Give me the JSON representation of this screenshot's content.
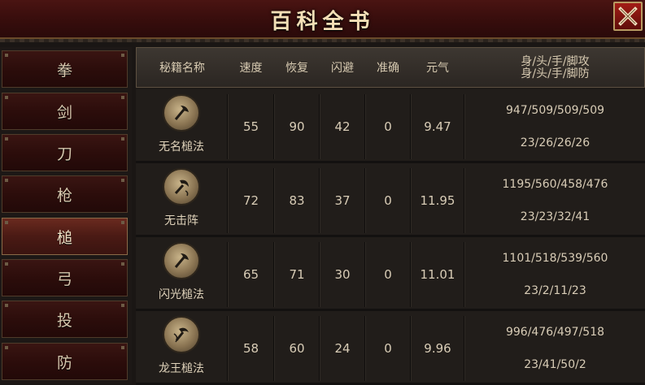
{
  "window": {
    "title": "百科全书",
    "close_label": "✕"
  },
  "nav": {
    "items": [
      {
        "label": "拳",
        "active": false
      },
      {
        "label": "剑",
        "active": false
      },
      {
        "label": "刀",
        "active": false
      },
      {
        "label": "枪",
        "active": false
      },
      {
        "label": "槌",
        "active": true
      },
      {
        "label": "弓",
        "active": false
      },
      {
        "label": "投",
        "active": false
      },
      {
        "label": "防",
        "active": false
      }
    ]
  },
  "table": {
    "headers": {
      "name": "秘籍名称",
      "speed": "速度",
      "recover": "恢复",
      "dodge": "闪避",
      "accuracy": "准确",
      "energy": "元气",
      "attack_line1": "身/头/手/脚攻",
      "attack_line2": "身/头/手/脚防"
    },
    "rows": [
      {
        "icon": "axe-icon",
        "name": "无名槌法",
        "speed": "55",
        "recover": "90",
        "dodge": "42",
        "accuracy": "0",
        "energy": "9.47",
        "attack": "947/509/509/509",
        "defense": "23/26/26/26"
      },
      {
        "icon": "hammer-swirl-icon",
        "name": "无击阵",
        "speed": "72",
        "recover": "83",
        "dodge": "37",
        "accuracy": "0",
        "energy": "11.95",
        "attack": "1195/560/458/476",
        "defense": "23/23/32/41"
      },
      {
        "icon": "axe-icon",
        "name": "闪光槌法",
        "speed": "65",
        "recover": "71",
        "dodge": "30",
        "accuracy": "0",
        "energy": "11.01",
        "attack": "1101/518/539/560",
        "defense": "23/2/11/23"
      },
      {
        "icon": "dragon-hammer-icon",
        "name": "龙王槌法",
        "speed": "58",
        "recover": "60",
        "dodge": "24",
        "accuracy": "0",
        "energy": "9.96",
        "attack": "996/476/497/518",
        "defense": "23/41/50/2"
      }
    ]
  }
}
